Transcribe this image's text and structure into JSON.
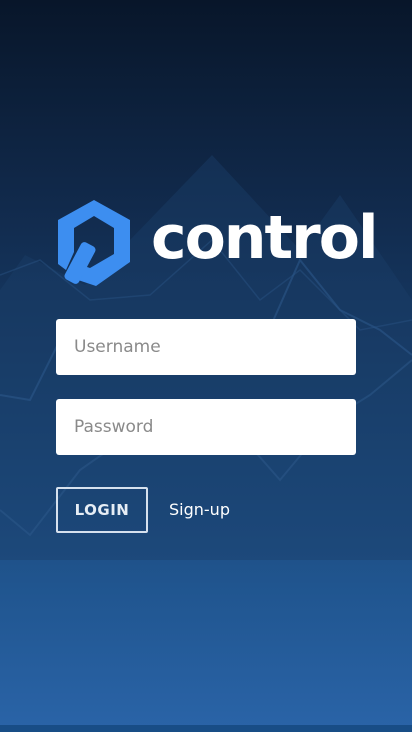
{
  "brand": {
    "logo_icon": "hexagon-key-icon",
    "name": "control",
    "accent_color": "#3d8ef0"
  },
  "login_form": {
    "username_placeholder": "Username",
    "username_value": "",
    "password_placeholder": "Password",
    "password_value": "",
    "login_label": "LOGIN",
    "signup_label": "Sign-up"
  },
  "colors": {
    "background_top": "#08162a",
    "background_bottom": "#2a64a8",
    "bottom_bar": "#184d86"
  }
}
